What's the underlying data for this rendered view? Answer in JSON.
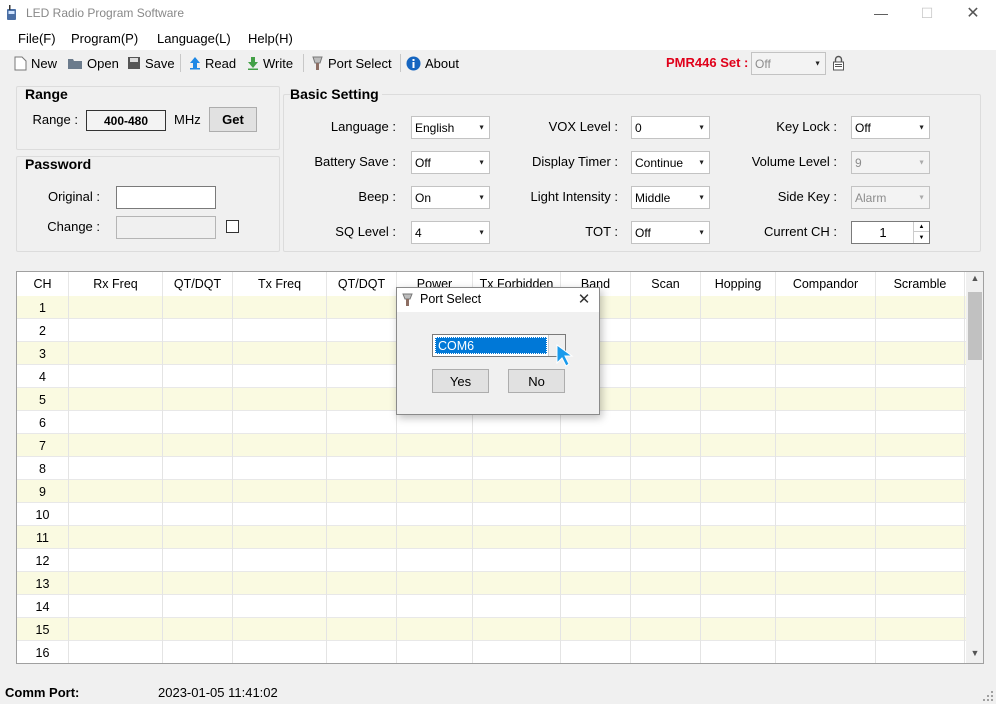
{
  "window": {
    "title": "LED Radio Program Software",
    "controls": {
      "minimize": "—",
      "maximize": "☐",
      "close": "✕"
    }
  },
  "menu": [
    "File(F)",
    "Program(P)",
    "Language(L)",
    "Help(H)"
  ],
  "toolbar": {
    "new_label": "New",
    "open_label": "Open",
    "save_label": "Save",
    "read_label": "Read",
    "write_label": "Write",
    "port_select_label": "Port Select",
    "about_label": "About",
    "pmr_label": "PMR446 Set :",
    "pmr_value": "Off"
  },
  "range": {
    "title": "Range",
    "label": "Range :",
    "value": "400-480",
    "unit": "MHz",
    "get_button": "Get"
  },
  "password": {
    "title": "Password",
    "original_label": "Original :",
    "original_value": "",
    "change_label": "Change :",
    "change_value": ""
  },
  "basic": {
    "title": "Basic Setting",
    "language_label": "Language :",
    "language_value": "English",
    "battery_label": "Battery Save :",
    "battery_value": "Off",
    "beep_label": "Beep :",
    "beep_value": "On",
    "sq_label": "SQ Level :",
    "sq_value": "4",
    "vox_label": "VOX Level :",
    "vox_value": "0",
    "display_timer_label": "Display Timer :",
    "display_timer_value": "Continue",
    "light_label": "Light Intensity :",
    "light_value": "Middle",
    "tot_label": "TOT :",
    "tot_value": "Off",
    "keylock_label": "Key Lock :",
    "keylock_value": "Off",
    "volume_label": "Volume Level :",
    "volume_value": "9",
    "sidekey_label": "Side Key :",
    "sidekey_value": "Alarm",
    "current_ch_label": "Current CH :",
    "current_ch_value": "1"
  },
  "grid": {
    "headers": [
      "CH",
      "Rx Freq",
      "QT/DQT",
      "Tx Freq",
      "QT/DQT",
      "Power",
      "Tx Forbidden",
      "Band",
      "Scan",
      "Hopping",
      "Compandor",
      "Scramble"
    ],
    "rows": [
      "1",
      "2",
      "3",
      "4",
      "5",
      "6",
      "7",
      "8",
      "9",
      "10",
      "11",
      "12",
      "13",
      "14",
      "15",
      "16"
    ]
  },
  "dialog": {
    "title": "Port Select",
    "close": "✕",
    "port_value": "COM6",
    "yes": "Yes",
    "no": "No"
  },
  "status": {
    "comm_label": "Comm Port:",
    "timestamp": "2023-01-05 11:41:02"
  },
  "colors": {
    "accent": "#0078d7",
    "pmr_red": "#e0001a",
    "row_alt": "#fafae1"
  }
}
